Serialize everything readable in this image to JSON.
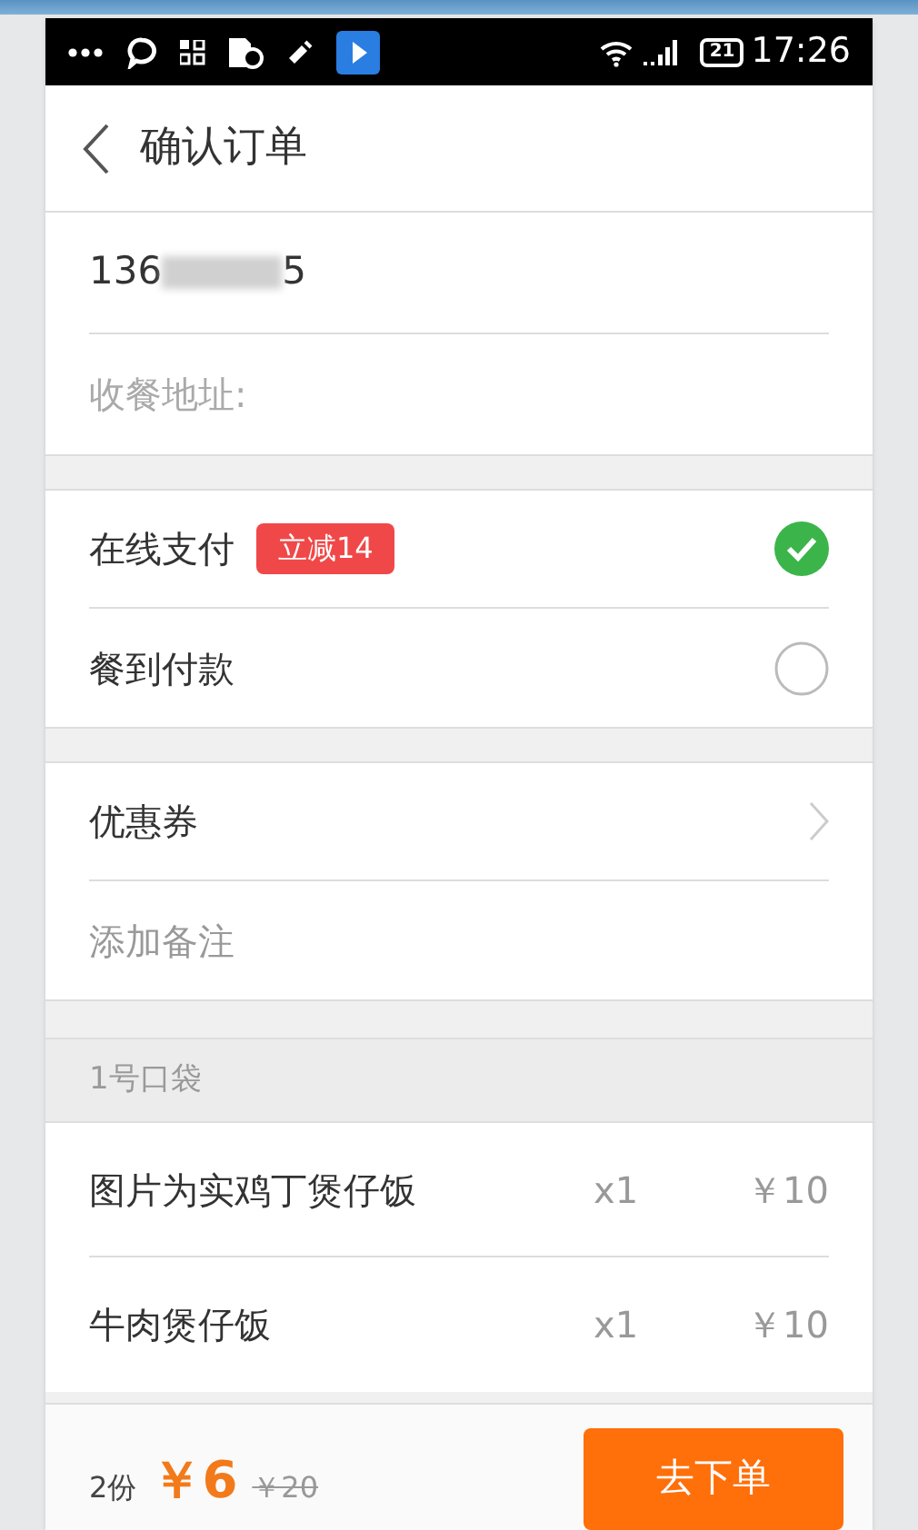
{
  "status_bar": {
    "battery": "21",
    "time": "17:26"
  },
  "header": {
    "title": "确认订单"
  },
  "contact": {
    "phone_start": "136",
    "phone_end": "5",
    "address_placeholder": "收餐地址:"
  },
  "payment_methods": [
    {
      "label": "在线支付",
      "badge": "立减14",
      "selected": true
    },
    {
      "label": "餐到付款",
      "selected": false
    }
  ],
  "extras": [
    {
      "label": "优惠券",
      "kind": "link"
    },
    {
      "placeholder": "添加备注",
      "kind": "input"
    }
  ],
  "bag": {
    "title": "1号口袋",
    "items": [
      {
        "name": "图片为实鸡丁煲仔饭",
        "qty": "x1",
        "price": "￥10"
      },
      {
        "name": "牛肉煲仔饭",
        "qty": "x1",
        "price": "￥10"
      }
    ]
  },
  "footer": {
    "count": "2份",
    "total": "￥6",
    "original": "￥20",
    "button": "去下单"
  }
}
